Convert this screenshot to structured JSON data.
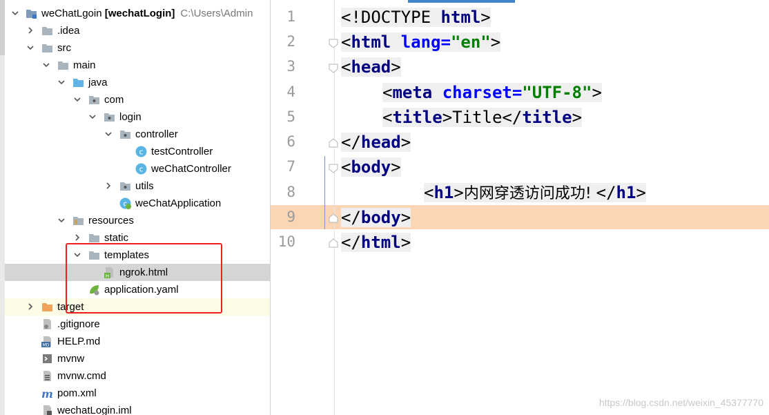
{
  "project_tree": {
    "root": {
      "name": "weChatLgoin",
      "module": "[wechatLogin]",
      "path": "C:\\Users\\Admin"
    },
    "items": [
      {
        "label": ".idea"
      },
      {
        "label": "src"
      },
      {
        "label": "main"
      },
      {
        "label": "java"
      },
      {
        "label": "com"
      },
      {
        "label": "login"
      },
      {
        "label": "controller"
      },
      {
        "label": "testController"
      },
      {
        "label": "weChatController"
      },
      {
        "label": "utils"
      },
      {
        "label": "weChatApplication"
      },
      {
        "label": "resources"
      },
      {
        "label": "static"
      },
      {
        "label": "templates"
      },
      {
        "label": "ngrok.html"
      },
      {
        "label": "application.yaml"
      },
      {
        "label": "target"
      },
      {
        "label": ".gitignore"
      },
      {
        "label": "HELP.md"
      },
      {
        "label": "mvnw"
      },
      {
        "label": "mvnw.cmd"
      },
      {
        "label": "pom.xml"
      },
      {
        "label": "wechatLogin.iml"
      }
    ]
  },
  "icons": {
    "expanded": "chevron-down-icon",
    "collapsed": "chevron-right-icon",
    "folder": "folder-icon",
    "java_class": "java-class-icon",
    "html_file": "html-file-icon"
  },
  "editor": {
    "line_numbers": [
      "1",
      "2",
      "3",
      "4",
      "5",
      "6",
      "7",
      "8",
      "9",
      "10"
    ],
    "lines": [
      {
        "p1": "<!DOCTYPE ",
        "p2": "html",
        "p3": ">"
      },
      {
        "p1": "<",
        "p2": "html ",
        "p3": "lang=",
        "p4": "\"en\"",
        "p5": ">"
      },
      {
        "p1": "<",
        "p2": "head",
        "p3": ">"
      },
      {
        "p1": "<",
        "p2": "meta ",
        "p3": "charset=",
        "p4": "\"UTF-8\"",
        "p5": ">"
      },
      {
        "p1": "<",
        "p2": "title",
        "p3": ">",
        "p4": "Title",
        "p5": "</",
        "p6": "title",
        "p7": ">"
      },
      {
        "p1": "</",
        "p2": "head",
        "p3": ">"
      },
      {
        "p1": "<",
        "p2": "body",
        "p3": ">"
      },
      {
        "p1": "<",
        "p2": "h1",
        "p3": ">",
        "p4": "内网穿透访问成功! ",
        "p5": "</",
        "p6": "h1",
        "p7": ">"
      },
      {
        "p1": "</",
        "p2": "body",
        "p3": ">"
      },
      {
        "p1": "</",
        "p2": "html",
        "p3": ">"
      }
    ],
    "current_line": "9",
    "watermark": "https://blog.csdn.net/weixin_45377770"
  },
  "colors": {
    "highlight_box": "#ee1f1f",
    "selected_row": "#d5d5d5",
    "current_line": "#fcd5b4",
    "tag_color": "#000080",
    "attr_color": "#0000ff",
    "string_color": "#007f00"
  }
}
